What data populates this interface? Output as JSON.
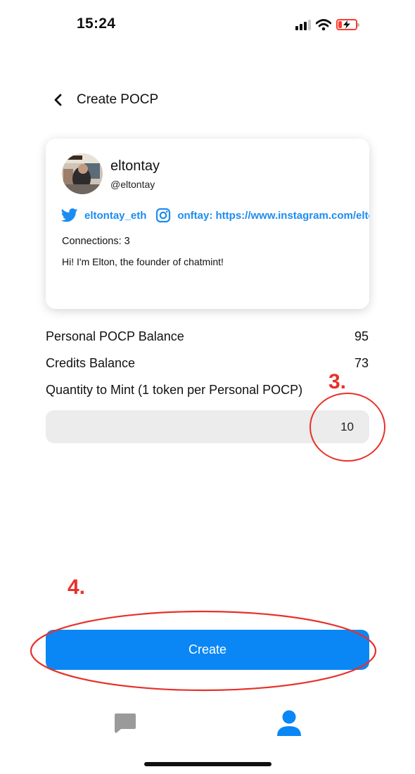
{
  "status_bar": {
    "time": "15:24",
    "icons": [
      "signal-icon",
      "wifi-icon",
      "battery-charging-icon"
    ],
    "battery_color": "#ff3b30"
  },
  "header": {
    "back_icon": "chevron-left-icon",
    "title": "Create POCP"
  },
  "profile": {
    "avatar_icon": "profile-photo",
    "name": "eltontay",
    "handle": "@eltontay",
    "twitter": {
      "icon": "twitter-icon",
      "label": "eltontay_eth"
    },
    "instagram": {
      "icon": "instagram-icon",
      "label": "onftay: https://www.instagram.com/elton"
    },
    "connections": "Connections: 3",
    "bio": "Hi! I'm Elton, the founder of chatmint!"
  },
  "balances": {
    "personal_label": "Personal POCP Balance",
    "personal_value": "95",
    "credits_label": "Credits Balance",
    "credits_value": "73",
    "quantity_label": "Quantity to Mint (1 token per Personal POCP)",
    "quantity_value": "10"
  },
  "annotations": {
    "step3": "3.",
    "step4": "4.",
    "color": "#e8302a"
  },
  "create_button": {
    "label": "Create",
    "color": "#0a87f5"
  },
  "tab_bar": {
    "chat_icon": "chat-bubble-icon",
    "chat_color": "#9a9a9a",
    "profile_icon": "user-icon",
    "profile_color": "#0a87f5"
  }
}
